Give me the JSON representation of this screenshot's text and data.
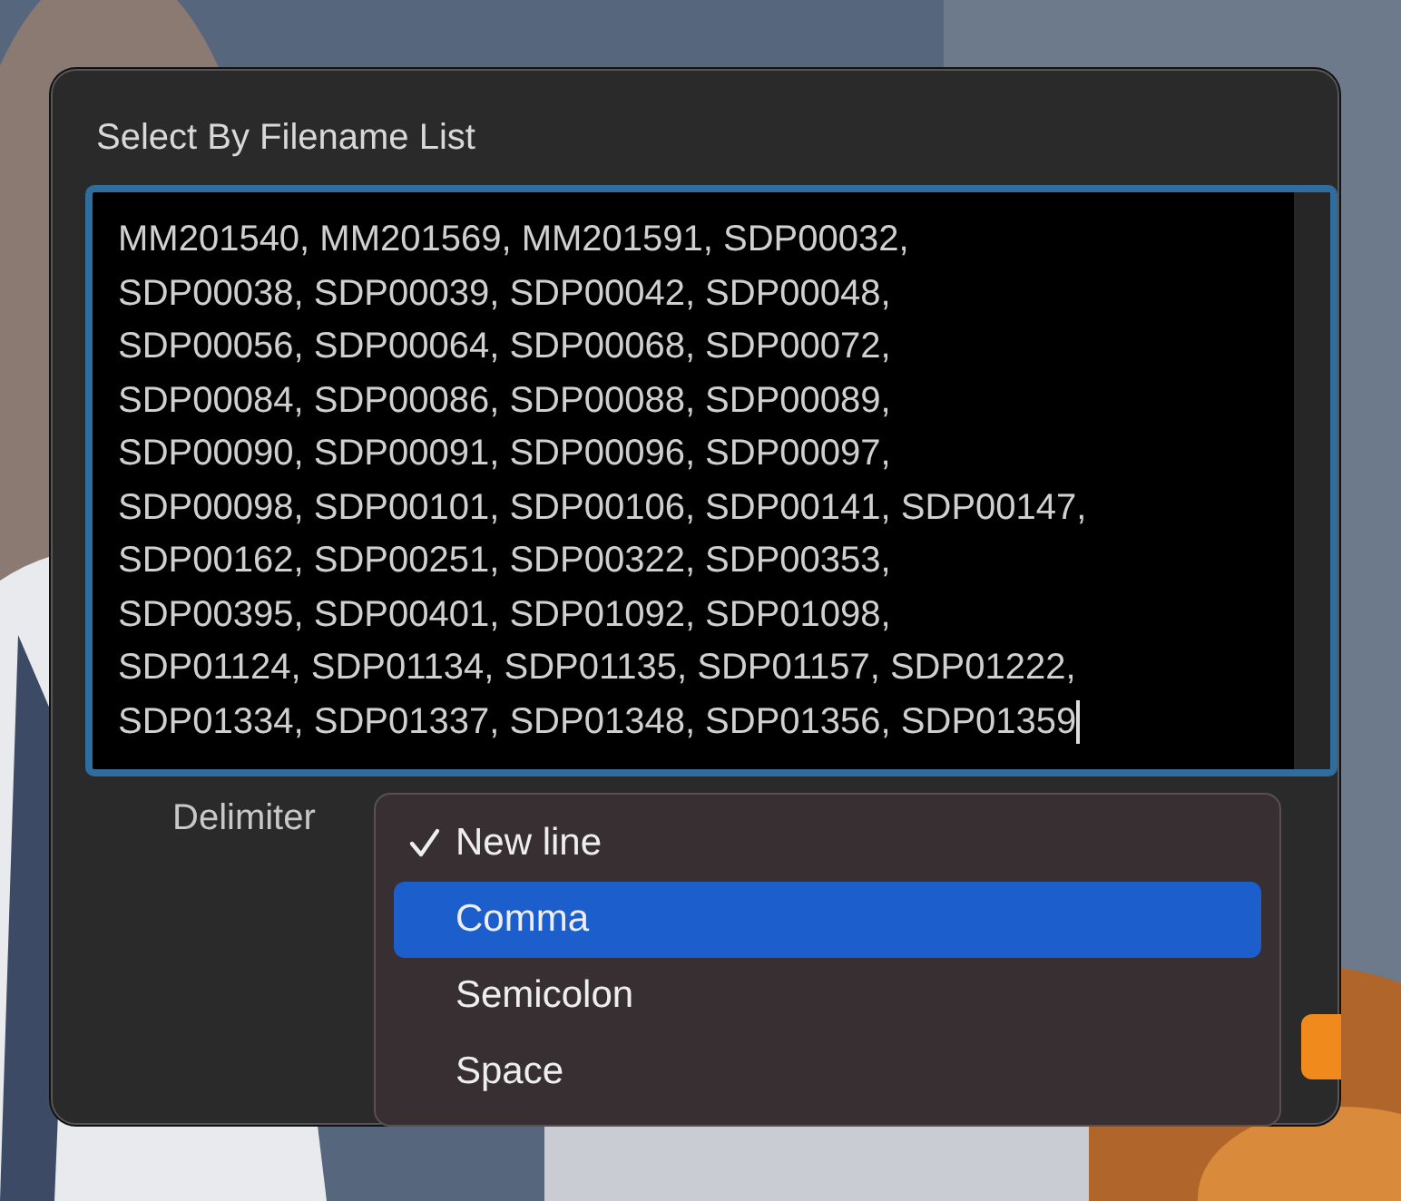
{
  "dialog": {
    "title": "Select By Filename List",
    "text_value": "MM201540, MM201569, MM201591, SDP00032,\nSDP00038, SDP00039, SDP00042, SDP00048,\nSDP00056, SDP00064, SDP00068, SDP00072,\nSDP00084, SDP00086, SDP00088, SDP00089,\nSDP00090, SDP00091, SDP00096, SDP00097,\nSDP00098, SDP00101, SDP00106, SDP00141, SDP00147,\nSDP00162, SDP00251, SDP00322, SDP00353,\nSDP00395, SDP00401, SDP01092, SDP01098,\nSDP01124, SDP01134, SDP01135, SDP01157, SDP01222,\nSDP01334, SDP01337, SDP01348, SDP01356, SDP01359",
    "delimiter_label": "Delimiter",
    "delimiter_menu": [
      {
        "label": "New line",
        "checked": true,
        "selected": false
      },
      {
        "label": "Comma",
        "checked": false,
        "selected": true
      },
      {
        "label": "Semicolon",
        "checked": false,
        "selected": false
      },
      {
        "label": "Space",
        "checked": false,
        "selected": false
      }
    ]
  }
}
